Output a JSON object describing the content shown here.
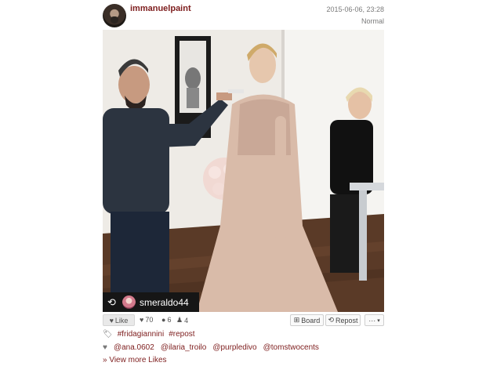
{
  "post": {
    "username": "immanuelpaint",
    "date": "2015-06-06, 23:28",
    "filter": "Normal"
  },
  "photo": {
    "description_icon": "photo-image"
  },
  "repost_badge": {
    "icon": "repost-icon",
    "username": "smeraldo44"
  },
  "actions": {
    "like_label": "Like",
    "likes_count": "70",
    "comments_count": "6",
    "reposts_count": "4",
    "board_label": "Board",
    "repost_label": "Repost",
    "more_label": "···"
  },
  "tags": [
    "#fridagiannini",
    "#repost"
  ],
  "mentions": [
    "@ana.0602",
    "@ilaria_troilo",
    "@purpledivo",
    "@tomstwocents"
  ],
  "view_more": "» View more Likes",
  "colors": {
    "link": "#7d1d1d",
    "badge_bg": "#161616"
  }
}
